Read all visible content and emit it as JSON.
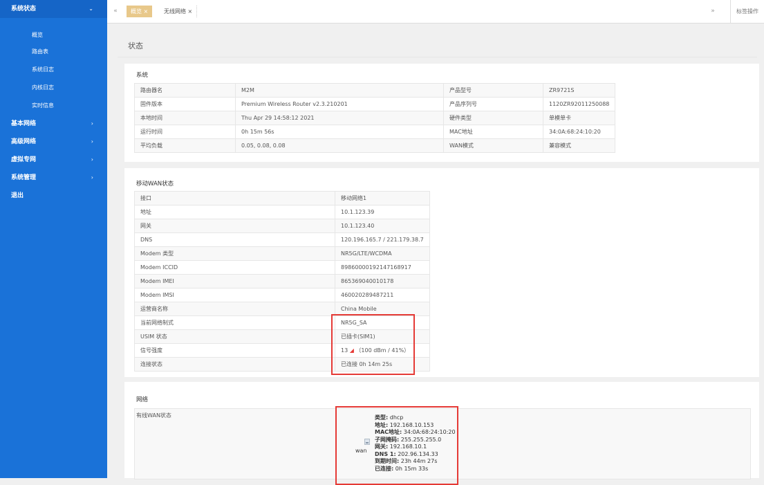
{
  "sidebar": {
    "sections": [
      {
        "label": "系统状态",
        "arrow": "⌄",
        "active": true
      },
      {
        "label": "基本网络",
        "arrow": "›"
      },
      {
        "label": "高级网络",
        "arrow": "›"
      },
      {
        "label": "虚拟专网",
        "arrow": "›"
      },
      {
        "label": "系统管理",
        "arrow": "›"
      },
      {
        "label": "退出",
        "arrow": ""
      }
    ],
    "sub_items": [
      "概览",
      "路由表",
      "系统日志",
      "内核日志",
      "实时信息"
    ]
  },
  "tabbar": {
    "prev": "«",
    "next": "»",
    "tabs": [
      {
        "label": "概览 ×"
      },
      {
        "label": "无线网络 ×"
      }
    ],
    "ops": "标签操作"
  },
  "page": {
    "title": "状态"
  },
  "system": {
    "title": "系统",
    "rows": [
      [
        "路由器名",
        "M2M",
        "产品型号",
        "ZR9721S"
      ],
      [
        "固件版本",
        "Premium Wireless Router v2.3.210201",
        "产品序列号",
        "1120ZR92011250088"
      ],
      [
        "本地时间",
        "Thu Apr 29 14:58:12 2021",
        "硬件类型",
        "单模单卡"
      ],
      [
        "运行时间",
        "0h 15m 56s",
        "MAC地址",
        "34:0A:68:24:10:20"
      ],
      [
        "平均负载",
        "0.05, 0.08, 0.08",
        "WAN模式",
        "兼容模式"
      ]
    ]
  },
  "wan": {
    "title": "移动WAN状态",
    "rows": [
      [
        "接口",
        "移动网络1"
      ],
      [
        "地址",
        "10.1.123.39"
      ],
      [
        "网关",
        "10.1.123.40"
      ],
      [
        "DNS",
        "120.196.165.7 / 221.179.38.7"
      ],
      [
        "Modem 类型",
        "NR5G/LTE/WCDMA"
      ],
      [
        "Modem ICCID",
        "89860000192147168917"
      ],
      [
        "Modem IMEI",
        "865369040010178"
      ],
      [
        "Modem IMSI",
        "460020289487211"
      ],
      [
        "运营商名称",
        "China Mobile"
      ],
      [
        "当前网络制式",
        "NR5G_SA"
      ],
      [
        "USIM 状态",
        "已插卡(SIM1)"
      ],
      [
        "信号强度",
        "13 ◢ （100 dBm / 41%）"
      ],
      [
        "连接状态",
        "已连接 0h 14m 25s"
      ]
    ]
  },
  "network": {
    "title": "网络",
    "row_label": "有线WAN状态",
    "iface_name": "wan",
    "icon": "network-port-icon",
    "details": [
      {
        "key": "类型:",
        "value": " dhcp"
      },
      {
        "key": "地址:",
        "value": " 192.168.10.153"
      },
      {
        "key": "MAC地址:",
        "value": " 34:0A:68:24:10:20"
      },
      {
        "key": "子网掩码:",
        "value": " 255.255.255.0"
      },
      {
        "key": "网关:",
        "value": " 192.168.10.1"
      },
      {
        "key": "DNS 1:",
        "value": " 202.96.134.33"
      },
      {
        "key": "到期时间:",
        "value": " 23h 44m 27s"
      },
      {
        "key": "已连接:",
        "value": " 0h 15m 33s"
      }
    ]
  },
  "colors": {
    "sidebar": "#1a72d8",
    "tab_active": "#e8c88a",
    "highlight": "#e53935"
  }
}
